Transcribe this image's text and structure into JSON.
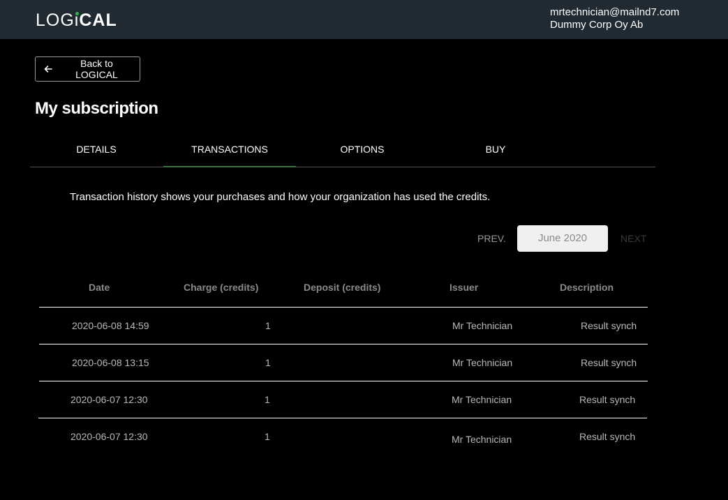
{
  "header": {
    "logo_text": {
      "part1": "LOG",
      "part2": "i",
      "part3": "CAL"
    },
    "logo_dot_color": "#2fb34a",
    "user_email": "mrtechnician@mailnd7.com",
    "organization": "Dummy Corp Oy Ab"
  },
  "back_button": {
    "label": "Back to LOGICAL",
    "icon": "arrow-left-icon"
  },
  "page_title": "My subscription",
  "tabs": [
    {
      "label": "DETAILS",
      "active": false
    },
    {
      "label": "TRANSACTIONS",
      "active": true
    },
    {
      "label": "OPTIONS",
      "active": false
    },
    {
      "label": "BUY",
      "active": false
    }
  ],
  "transactions": {
    "intro": "Transaction history shows your purchases and how your organization has used the credits.",
    "pager": {
      "prev_label": "PREV.",
      "month": "June 2020",
      "next_label": "NEXT"
    },
    "columns": [
      "Date",
      "Charge (credits)",
      "Deposit (credits)",
      "Issuer",
      "Description"
    ],
    "rows": [
      {
        "date": "2020-06-08 14:59",
        "charge": "1",
        "deposit": "",
        "issuer": "Mr Technician",
        "description": "Result synch"
      },
      {
        "date": "2020-06-08 13:15",
        "charge": "1",
        "deposit": "",
        "issuer": "Mr Technician",
        "description": "Result synch"
      },
      {
        "date": "2020-06-07 12:30",
        "charge": "1",
        "deposit": "",
        "issuer": "Mr Technician",
        "description": "Result synch"
      },
      {
        "date": "2020-06-07 12:30",
        "charge": "1",
        "deposit": "",
        "issuer": "Mr Technician",
        "description": "Result synch"
      }
    ]
  },
  "colors": {
    "header_bg": "#1f2a33",
    "active_tab_underline": "#2e7d32",
    "background": "#000000"
  }
}
